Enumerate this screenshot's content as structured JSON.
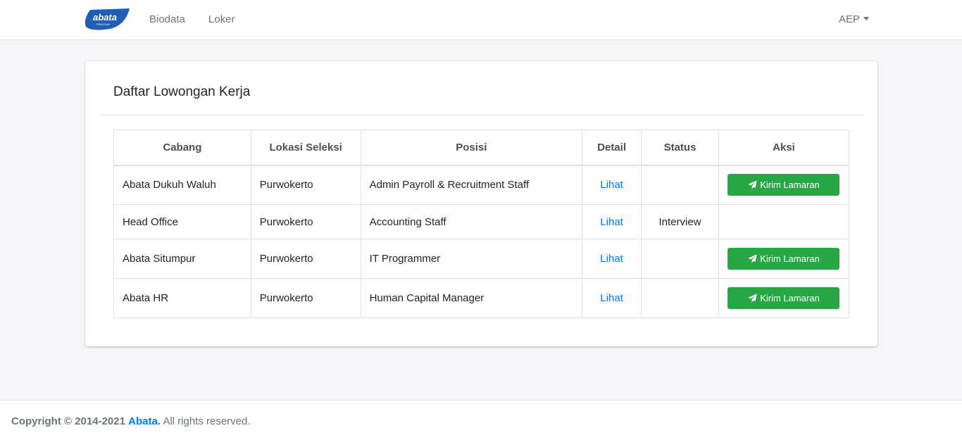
{
  "nav": {
    "logo_text": "abata",
    "logo_subtext": "PRINTING",
    "links": [
      "Biodata",
      "Loker"
    ],
    "user": "AEP"
  },
  "card": {
    "title": "Daftar Lowongan Kerja"
  },
  "table": {
    "headers": [
      "Cabang",
      "Lokasi Seleksi",
      "Posisi",
      "Detail",
      "Status",
      "Aksi"
    ],
    "rows": [
      {
        "cabang": "Abata Dukuh Waluh",
        "lokasi": "Purwokerto",
        "posisi": "Admin Payroll & Recruitment Staff",
        "detail": "Lihat",
        "status": "",
        "action": "Kirim Lamaran"
      },
      {
        "cabang": "Head Office",
        "lokasi": "Purwokerto",
        "posisi": "Accounting Staff",
        "detail": "Lihat",
        "status": "Interview",
        "action": ""
      },
      {
        "cabang": "Abata Situmpur",
        "lokasi": "Purwokerto",
        "posisi": "IT Programmer",
        "detail": "Lihat",
        "status": "",
        "action": "Kirim Lamaran"
      },
      {
        "cabang": "Abata HR",
        "lokasi": "Purwokerto",
        "posisi": "Human Capital Manager",
        "detail": "Lihat",
        "status": "",
        "action": "Kirim Lamaran"
      }
    ]
  },
  "footer": {
    "prefix": "Copyright © 2014-2021",
    "brand": "Abata.",
    "suffix": "All rights reserved."
  },
  "colors": {
    "primary": "#007bff",
    "success": "#28a745",
    "logo": "#1e5fb3"
  },
  "icons": {
    "send": "paper-plane-icon",
    "dropdown": "caret-down-icon"
  }
}
